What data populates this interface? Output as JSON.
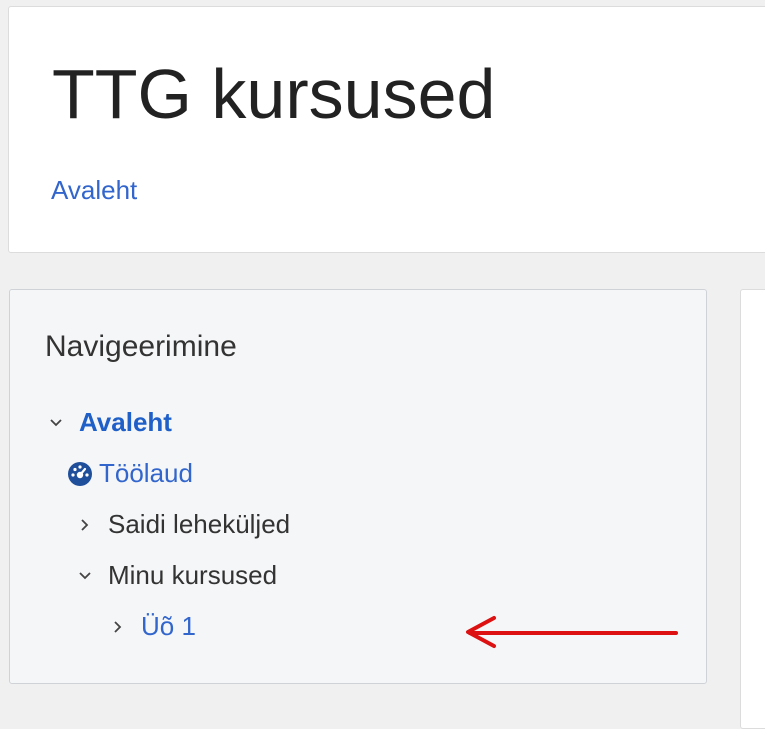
{
  "header": {
    "site_title": "TTG kursused",
    "breadcrumb_home": "Avaleht"
  },
  "navigation": {
    "title": "Navigeerimine",
    "items": [
      {
        "label": "Avaleht",
        "icon": "chevron-down-icon",
        "expanded": true
      },
      {
        "label": "Töölaud",
        "icon": "dashboard-gauge-icon"
      },
      {
        "label": "Saidi leheküljed",
        "icon": "chevron-right-icon",
        "expanded": false
      },
      {
        "label": "Minu kursused",
        "icon": "chevron-down-icon",
        "expanded": true
      },
      {
        "label": "Üõ 1",
        "icon": "chevron-right-icon",
        "expanded": false
      }
    ]
  },
  "annotation": {
    "arrow_color": "#dd1111",
    "arrow_direction": "left"
  },
  "colors": {
    "link": "#3366cc",
    "active_link": "#1f5fc8",
    "text": "#333333"
  }
}
